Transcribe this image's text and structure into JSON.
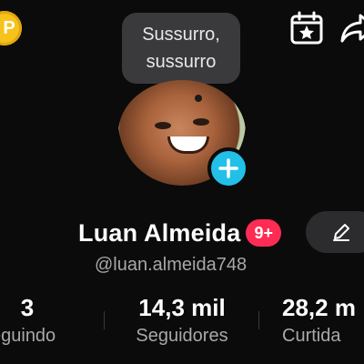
{
  "header": {
    "coin_label": "P"
  },
  "tooltip": {
    "line1": "Sussurro,",
    "line2": "sussurro"
  },
  "profile": {
    "name": "Luan Almeida",
    "badge": "9+",
    "username": "@luan.almeida748"
  },
  "stats": [
    {
      "value": "3",
      "label": "eguindo"
    },
    {
      "value": "14,3 mil",
      "label": "Seguidores"
    },
    {
      "value": "28,2 m",
      "label": "Curtida"
    }
  ],
  "colors": {
    "background": "#0b0b0b",
    "accent_add": "#22c0e8",
    "badge": "#fe2c55",
    "coin": "#f7c21b",
    "secondary_text": "#a8a8a8"
  },
  "icons": [
    "coin-icon",
    "calendar-star-icon",
    "share-icon",
    "add-icon",
    "edit-pencil-icon"
  ]
}
